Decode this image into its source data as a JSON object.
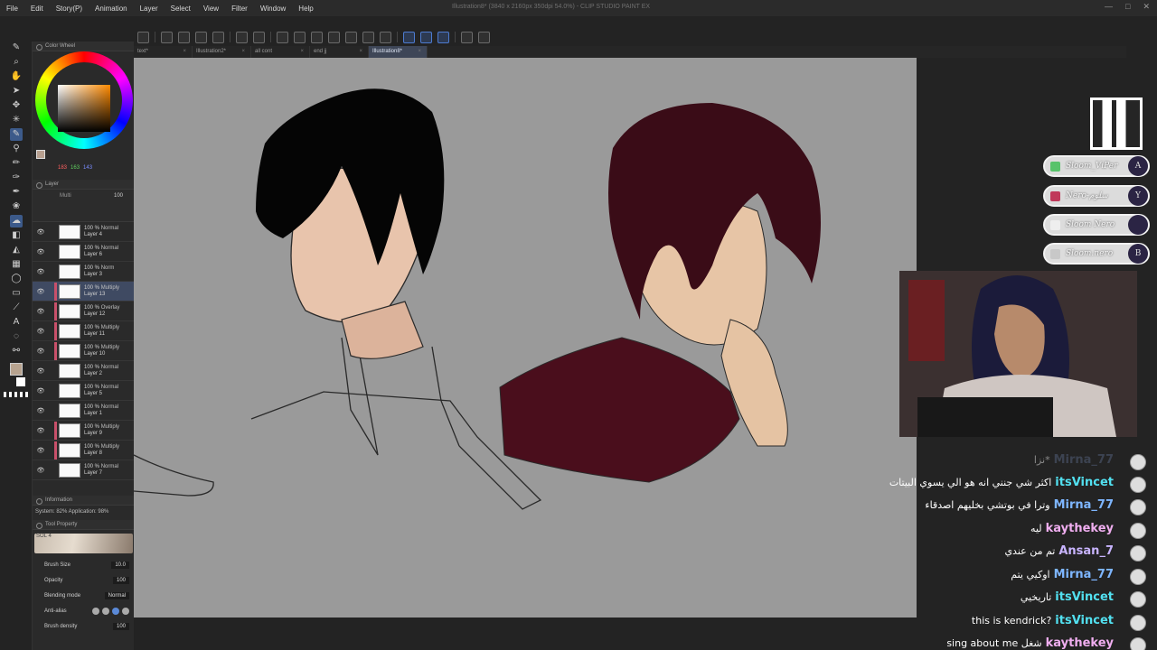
{
  "window": {
    "title": "Illustration8* (3840 x 2160px 350dpi 54.0%) - CLIP STUDIO PAINT EX"
  },
  "menu": [
    "File",
    "Edit",
    "Story(P)",
    "Animation",
    "Layer",
    "Select",
    "View",
    "Filter",
    "Window",
    "Help"
  ],
  "tabs": [
    {
      "label": "text*",
      "active": false
    },
    {
      "label": "Illustration2*",
      "active": false
    },
    {
      "label": "all cont",
      "active": false
    },
    {
      "label": "end jj",
      "active": false
    },
    {
      "label": "Illustration8*",
      "active": true
    }
  ],
  "color_wheel": {
    "title": "Color Wheel",
    "r": "183",
    "g": "163",
    "b": "143",
    "current_color": "#b7a38f"
  },
  "layer_panel": {
    "title": "Layer",
    "mode_label": "Multi",
    "opacity": "100",
    "layers": [
      {
        "opacity": "100 %",
        "blend": "Normal",
        "name": "Layer 4",
        "edge": false,
        "active": false
      },
      {
        "opacity": "100 %",
        "blend": "Normal",
        "name": "Layer 6",
        "edge": false,
        "active": false
      },
      {
        "opacity": "100 %",
        "blend": "Norm",
        "name": "Layer 3",
        "edge": false,
        "active": false
      },
      {
        "opacity": "100 %",
        "blend": "Multiply",
        "name": "Layer 13",
        "edge": true,
        "active": true
      },
      {
        "opacity": "100 %",
        "blend": "Overlay",
        "name": "Layer 12",
        "edge": true,
        "active": false
      },
      {
        "opacity": "100 %",
        "blend": "Multiply",
        "name": "Layer 11",
        "edge": true,
        "active": false
      },
      {
        "opacity": "100 %",
        "blend": "Multiply",
        "name": "Layer 10",
        "edge": true,
        "active": false
      },
      {
        "opacity": "100 %",
        "blend": "Normal",
        "name": "Layer 2",
        "edge": false,
        "active": false
      },
      {
        "opacity": "100 %",
        "blend": "Normal",
        "name": "Layer 5",
        "edge": false,
        "active": false
      },
      {
        "opacity": "100 %",
        "blend": "Normal",
        "name": "Layer 1",
        "edge": false,
        "active": false
      },
      {
        "opacity": "100 %",
        "blend": "Multiply",
        "name": "Layer 9",
        "edge": true,
        "active": false
      },
      {
        "opacity": "100 %",
        "blend": "Multiply",
        "name": "Layer 8",
        "edge": true,
        "active": false
      },
      {
        "opacity": "100 %",
        "blend": "Normal",
        "name": "Layer 7",
        "edge": false,
        "active": false
      }
    ]
  },
  "info": {
    "title": "Information",
    "system": "System: 82%  Application: 98%"
  },
  "tool_property": {
    "title": "Tool Property",
    "brush_name": "SOL 4",
    "brush_size_label": "Brush Size",
    "brush_size": "10.0",
    "opacity_label": "Opacity",
    "opacity": "100",
    "blending_label": "Blending mode",
    "blending": "Normal",
    "antialias_label": "Anti-alias",
    "density_label": "Brush density",
    "density": "100"
  },
  "stream": {
    "socials": [
      {
        "handle": "Sloom_ViPer",
        "letter": "A",
        "icon_color": "#58c36b"
      },
      {
        "handle": "Nero-سلوم",
        "letter": "Y",
        "icon_color": "#c0395a"
      },
      {
        "handle": "Sloom Nero",
        "letter": "",
        "icon_color": "#eeeeee"
      },
      {
        "handle": "Sloom.nero",
        "letter": "B",
        "icon_color": "#c8c8c8"
      }
    ],
    "chat": [
      {
        "name": "Mirna_77",
        "message": "نزا*",
        "name_color": "#5c6a8a",
        "faded": true
      },
      {
        "name": "itsVincet",
        "message": "اكثر شي جنني انه هو الي يسوي البيتات",
        "name_color": "#52e0f0",
        "faded": false
      },
      {
        "name": "Mirna_77",
        "message": "وترا في بوتشي بخليهم اصدقاء",
        "name_color": "#7eb6ff",
        "faded": false
      },
      {
        "name": "kaythekey",
        "message": "ليه",
        "name_color": "#f0aef0",
        "faded": false
      },
      {
        "name": "Ansan_7",
        "message": "تم من عندي",
        "name_color": "#c8b4ff",
        "faded": false
      },
      {
        "name": "Mirna_77",
        "message": "اوكيي يتم",
        "name_color": "#7eb6ff",
        "faded": false
      },
      {
        "name": "itsVincet",
        "message": "تاريخيي",
        "name_color": "#52e0f0",
        "faded": false
      },
      {
        "name": "itsVincet",
        "message": "this is kendrick?",
        "name_color": "#52e0f0",
        "faded": false
      },
      {
        "name": "kaythekey",
        "message": "sing about me شغل",
        "name_color": "#f0aef0",
        "faded": false
      }
    ]
  }
}
